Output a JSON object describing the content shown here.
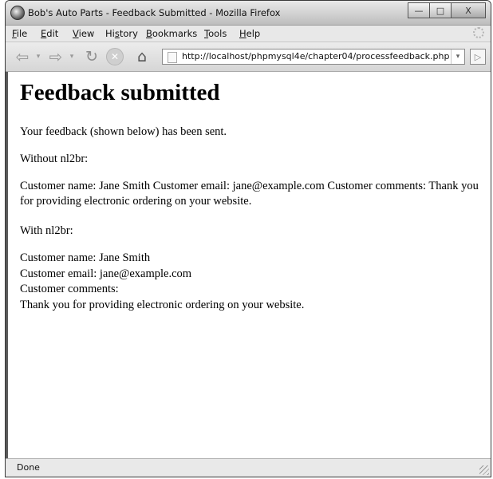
{
  "window": {
    "title": "Bob's Auto Parts - Feedback Submitted - Mozilla Firefox",
    "min_glyph": "—",
    "max_glyph": "□",
    "close_glyph": "X"
  },
  "menu": {
    "file": "ile",
    "file_key": "F",
    "edit": "dit",
    "edit_key": "E",
    "view": "iew",
    "view_key": "V",
    "history_pre": "Hi",
    "history_key": "s",
    "history_post": "tory",
    "bookmarks": "ookmarks",
    "bookmarks_key": "B",
    "tools": "ools",
    "tools_key": "T",
    "help": "elp",
    "help_key": "H"
  },
  "nav": {
    "back_glyph": "⇦",
    "forward_glyph": "⇨",
    "drop_glyph": "▾",
    "reload_glyph": "↻",
    "stop_glyph": "✕",
    "home_glyph": "⌂",
    "url": "http://localhost/phpmysql4e/chapter04/processfeedback.php",
    "url_drop_glyph": "▾",
    "go_glyph": "▷"
  },
  "page": {
    "heading": "Feedback submitted",
    "intro": "Your feedback (shown below) has been sent.",
    "without_label": "Without nl2br:",
    "without_text": "Customer name: Jane Smith Customer email: jane@example.com Customer comments: Thank you for providing electronic ordering on your website.",
    "with_label": "With nl2br:",
    "with_lines": [
      "Customer name: Jane Smith",
      "Customer email: jane@example.com",
      "Customer comments:",
      "Thank you for providing electronic ordering on your website."
    ]
  },
  "status": {
    "text": "Done"
  }
}
